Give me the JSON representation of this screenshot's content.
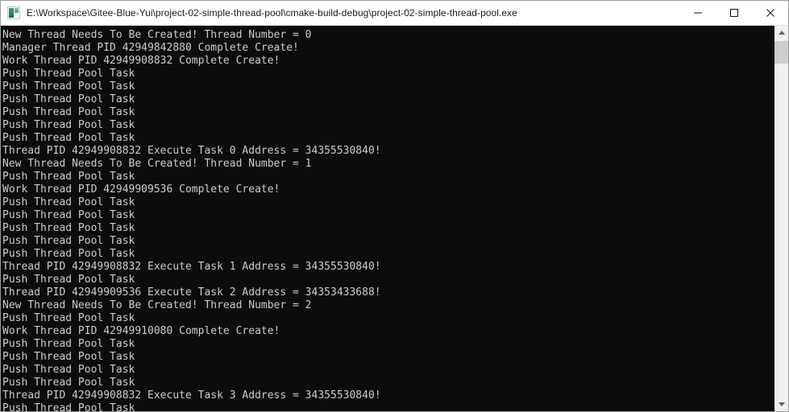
{
  "window": {
    "title": "E:\\Workspace\\Gitee-Blue-Yui\\project-02-simple-thread-pool\\cmake-build-debug\\project-02-simple-thread-pool.exe",
    "icon": "console-app-icon",
    "background_color": "#0c0c0c",
    "titlebar_color": "#ffffff",
    "text_color": "#cccccc",
    "controls": {
      "minimize_label": "—",
      "maximize_label": "☐",
      "close_label": "✕"
    }
  },
  "scrollbar": {
    "up_arrow": "chevron-up-icon",
    "down_arrow": "chevron-down-icon",
    "thumb_position": "top"
  },
  "console": {
    "lines": [
      "New Thread Needs To Be Created! Thread Number = 0",
      "Manager Thread PID 42949842880 Complete Create!",
      "Work Thread PID 42949908832 Complete Create!",
      "Push Thread Pool Task",
      "Push Thread Pool Task",
      "Push Thread Pool Task",
      "Push Thread Pool Task",
      "Push Thread Pool Task",
      "Push Thread Pool Task",
      "Thread PID 42949908832 Execute Task 0 Address = 34355530840!",
      "New Thread Needs To Be Created! Thread Number = 1",
      "Push Thread Pool Task",
      "Work Thread PID 42949909536 Complete Create!",
      "Push Thread Pool Task",
      "Push Thread Pool Task",
      "Push Thread Pool Task",
      "Push Thread Pool Task",
      "Push Thread Pool Task",
      "Thread PID 42949908832 Execute Task 1 Address = 34355530840!",
      "Push Thread Pool Task",
      "Thread PID 42949909536 Execute Task 2 Address = 34353433688!",
      "New Thread Needs To Be Created! Thread Number = 2",
      "Push Thread Pool Task",
      "Work Thread PID 42949910080 Complete Create!",
      "Push Thread Pool Task",
      "Push Thread Pool Task",
      "Push Thread Pool Task",
      "Push Thread Pool Task",
      "Thread PID 42949908832 Execute Task 3 Address = 34355530840!",
      "Push Thread Pool Task"
    ]
  }
}
